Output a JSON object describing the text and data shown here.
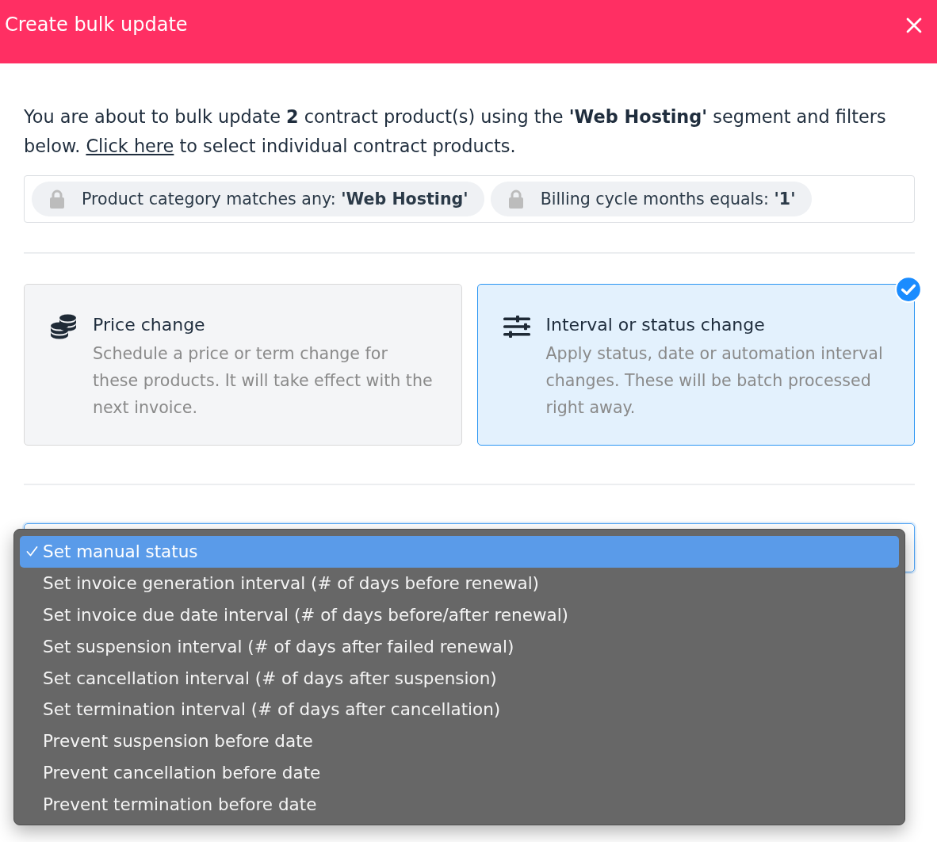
{
  "dialog": {
    "title": "Create bulk update"
  },
  "intro": {
    "text_before": "You are about to bulk update **2** contract product(s) using the **'Web Hosting'** segment and filters below.",
    "link": "Click here",
    "text_after": "to select individual contract products."
  },
  "filters": [
    {
      "text": "Product category matches any: **'Web Hosting'**",
      "locked": true
    },
    {
      "text": "Billing cycle months equals: **'1'**",
      "locked": true
    }
  ],
  "update_types": [
    {
      "kind": "price",
      "title": "Price change",
      "description": "Schedule a price or term change for these products. It will take effect with the next invoice.",
      "selected": false
    },
    {
      "kind": "interval",
      "title": "Interval or status change",
      "description": "Apply status, date or automation interval changes. These will be batch processed right away.",
      "selected": true
    }
  ],
  "select": {
    "expanded": true,
    "options": [
      {
        "label": "Set manual status",
        "selected": true
      },
      {
        "label": "Set invoice generation interval (# of days before renewal)",
        "selected": false
      },
      {
        "label": "Set invoice due date interval (# of days before/after renewal)",
        "selected": false
      },
      {
        "label": "Set suspension interval (# of days after failed renewal)",
        "selected": false
      },
      {
        "label": "Set cancellation interval (# of days after suspension)",
        "selected": false
      },
      {
        "label": "Set termination interval (# of days after cancellation)",
        "selected": false
      },
      {
        "label": "Prevent suspension before date",
        "selected": false
      },
      {
        "label": "Prevent cancellation before date",
        "selected": false
      },
      {
        "label": "Prevent termination before date",
        "selected": false
      }
    ]
  }
}
